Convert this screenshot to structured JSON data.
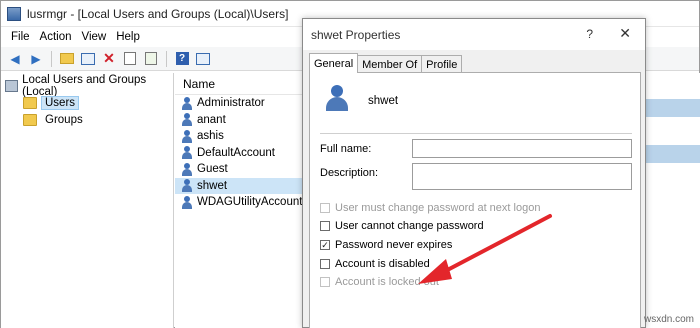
{
  "mmc": {
    "title": "lusrmgr - [Local Users and Groups (Local)\\Users]",
    "menu": [
      "File",
      "Action",
      "View",
      "Help"
    ],
    "tree": {
      "root": "Local Users and Groups (Local)",
      "items": [
        "Users",
        "Groups"
      ]
    },
    "list": {
      "header": "Name",
      "rows": [
        "Administrator",
        "anant",
        "ashis",
        "DefaultAccount",
        "Guest",
        "shwet",
        "WDAGUtilityAccount"
      ],
      "selected": "shwet"
    }
  },
  "dialog": {
    "title": "shwet Properties",
    "help_glyph": "?",
    "close_glyph": "✕",
    "tabs": [
      "General",
      "Member Of",
      "Profile"
    ],
    "active_tab": "General",
    "username": "shwet",
    "fields": {
      "full_name_label": "Full name:",
      "full_name_value": "",
      "description_label": "Description:",
      "description_value": ""
    },
    "checkboxes": [
      {
        "label": "User must change password at next logon",
        "checked": false,
        "disabled": true
      },
      {
        "label": "User cannot change password",
        "checked": false,
        "disabled": false
      },
      {
        "label": "Password never expires",
        "checked": true,
        "disabled": false
      },
      {
        "label": "Account is disabled",
        "checked": false,
        "disabled": false
      },
      {
        "label": "Account is locked out",
        "checked": false,
        "disabled": true
      }
    ]
  },
  "watermark": "wsxdn.com",
  "colors": {
    "arrow": "#e3262b",
    "selection": "#cce4f7"
  }
}
